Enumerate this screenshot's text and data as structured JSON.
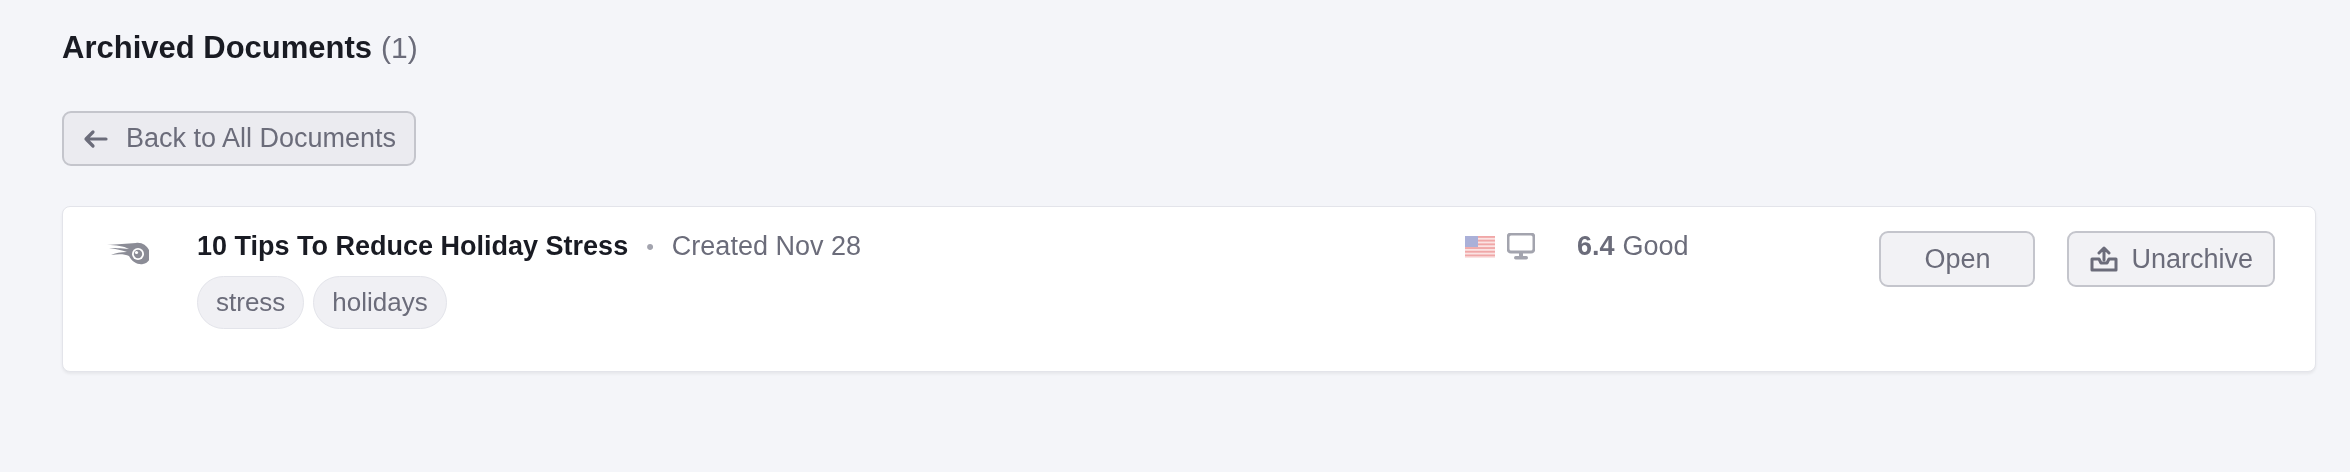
{
  "header": {
    "title": "Archived Documents",
    "count": "(1)"
  },
  "back_button": {
    "label": "Back to All Documents"
  },
  "documents": [
    {
      "title": "10 Tips To Reduce Holiday Stress",
      "separator": "•",
      "created": "Created Nov 28",
      "tags": [
        "stress",
        "holidays"
      ],
      "score": "6.4",
      "score_label": "Good",
      "actions": [
        {
          "label": "Open",
          "kind": "plain"
        },
        {
          "label": "Unarchive",
          "kind": "unarchive"
        }
      ]
    }
  ]
}
